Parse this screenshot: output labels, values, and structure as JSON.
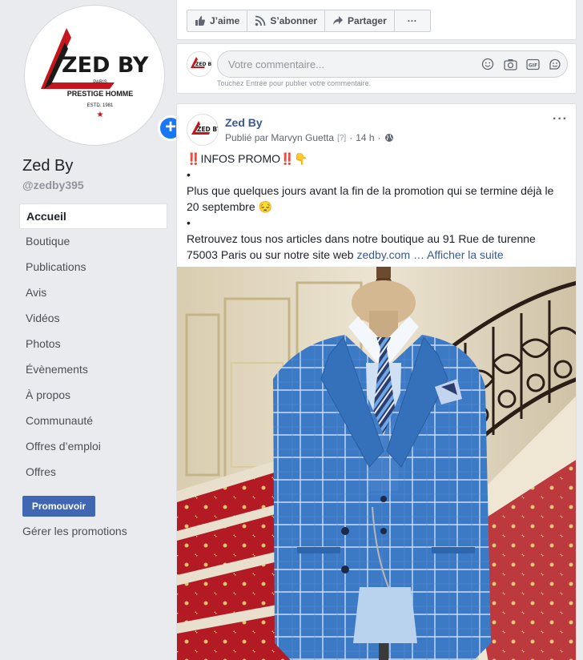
{
  "sidebar": {
    "logo": {
      "brand": "ZED BY",
      "city": "PARIS",
      "tagline": "PRESTIGE HOMME",
      "established": "ESTD. 1981"
    },
    "page_name": "Zed By",
    "handle": "@zedby395",
    "nav": [
      {
        "label": "Accueil",
        "active": true
      },
      {
        "label": "Boutique"
      },
      {
        "label": "Publications"
      },
      {
        "label": "Avis"
      },
      {
        "label": "Vidéos"
      },
      {
        "label": "Photos"
      },
      {
        "label": "Évènements"
      },
      {
        "label": "À propos"
      },
      {
        "label": "Communauté"
      },
      {
        "label": "Offres d’emploi"
      },
      {
        "label": "Offres"
      }
    ],
    "promote_label": "Promouvoir",
    "manage_promotions": "Gérer les promotions"
  },
  "action_bar": {
    "like": "J’aime",
    "subscribe": "S’abonner",
    "share": "Partager",
    "more": "···"
  },
  "comment_box": {
    "placeholder": "Votre commentaire...",
    "hint": "Touchez Entrée pour publier votre commentaire.",
    "icons": [
      "emoji-icon",
      "camera-icon",
      "gif-icon",
      "sticker-icon"
    ]
  },
  "post": {
    "author": "Zed By",
    "published_by": "Publié par Marvyn Guetta",
    "help_marker": "[?]",
    "time": "14 h",
    "audience_icon": "globe-icon",
    "menu": "···",
    "line1_emoji_left": "‼️",
    "line1_text": "INFOS PROMO",
    "line1_emoji_right": "‼️👇",
    "bullet": "•",
    "line2": "Plus que quelques jours avant la fin de la promotion qui se termine déjà le 20 septembre 😔",
    "line3": "Retrouvez tous nos articles dans notre boutique au 91 Rue de turenne 75003 Paris ou sur notre site web ",
    "link": "zedby.com",
    "ellipsis": " … ",
    "see_more": "Afficher la suite"
  },
  "colors": {
    "facebook_blue": "#4267b2",
    "link_blue": "#385898",
    "logo_red": "#c4161c",
    "suit_blue": "#3b78c4"
  }
}
